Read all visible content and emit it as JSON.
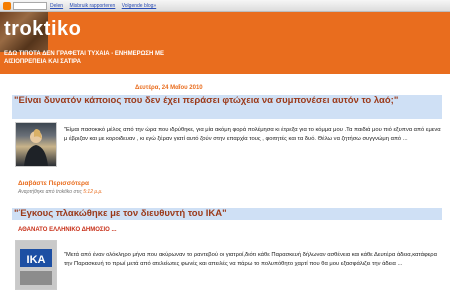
{
  "navbar": {
    "links": [
      "Delen",
      "Misbruik rapporteren",
      "Volgende blog»"
    ]
  },
  "header": {
    "title": "troktiko",
    "description": "ΕΔΩ ΤΙΠΟΤΑ ΔΕΝ ΓΡΑΦΕΤΑΙ ΤΥΧΑΙΑ - ΕΝΗΜΕΡΩΣΗ ΜΕ ΑΙΣΙΟΠΡΕΠΕΙΑ ΚΑΙ ΣΑΤΙΡΑ",
    "background_color": "#e96d1e"
  },
  "posts": [
    {
      "date": "Δευτέρα, 24 Μαΐου 2010",
      "title": "\"Είναι δυνατόν κάποιος που δεν έχει περάσει φτώχεια να συμπονέσει αυτόν το λαό;\"",
      "body": "\"Είμαι πασοκικό μέλος από την ώρα που ιδρύθηκε, για μία ακόμη φορά πολέμησα κι έτρεξα για το κόμμα μου .Τα παιδιά μου πιό εξυπνα από εμενα μ έβριζαν και με κοροιδευαν , κι εγώ ξέραν γιατί αυτό ζούν στην επαρχία τους , φοιτητές και τα δυό. Θέλω να ζητήσω συγγνώμη από ...",
      "read_more": "Διαβάστε Περισσότερα",
      "footer_prefix": "Αναρτήθηκε από troktiko στις",
      "footer_time": "5:12 μ.μ."
    },
    {
      "title": "\"Έγκους πλακώθηκε με τον διευθυντή του ΙΚΑ\"",
      "subheading": "ΑΘΑΝΑΤΟ ΕΛΛΗΝΙΚΟ ΔΗΜΟΣΙΟ ...",
      "body": "\"Μετά από έναν ολόκληρο μήνα που ακύρωναν το ραντεβού οι γιατροί,διότι κάθε Παρασκευή δήλωναν ασθένεια και κάθε Δευτέρα άδεια,κατάφερα την Παρασκευή το πρωί μετά από ατελείωτες φωνές και απειλές να πάρω το πολυπόθητο χαρτί που θα μου εξασφάλιζει την άδεια ...",
      "sign_text": "ΙΚΑ"
    }
  ]
}
